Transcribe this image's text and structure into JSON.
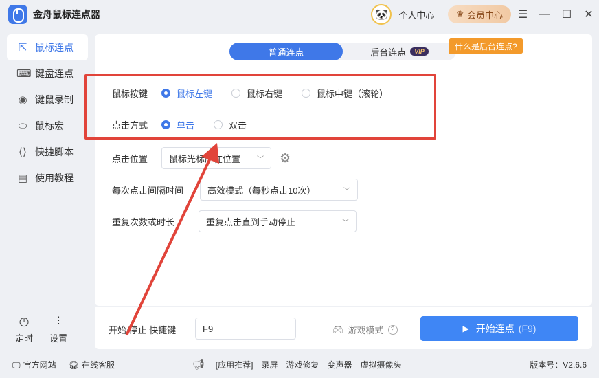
{
  "app": {
    "title": "金舟鼠标连点器"
  },
  "header": {
    "user_center": "个人中心",
    "vip_center": "会员中心"
  },
  "sidebar": {
    "items": [
      {
        "label": "鼠标连点",
        "icon": "mouse-click-icon"
      },
      {
        "label": "键盘连点",
        "icon": "keyboard-icon"
      },
      {
        "label": "键鼠录制",
        "icon": "record-icon"
      },
      {
        "label": "鼠标宏",
        "icon": "mouse-icon"
      },
      {
        "label": "快捷脚本",
        "icon": "script-icon"
      },
      {
        "label": "使用教程",
        "icon": "tutorial-icon"
      }
    ],
    "timer": "定时",
    "settings": "设置"
  },
  "tabs": {
    "normal": "普通连点",
    "background": "后台连点",
    "vip_tag": "VIP",
    "tip": "什么是后台连点?"
  },
  "form": {
    "mouse_button_label": "鼠标按键",
    "mouse_buttons": [
      "鼠标左键",
      "鼠标右键",
      "鼠标中键（滚轮）"
    ],
    "click_type_label": "点击方式",
    "click_types": [
      "单击",
      "双击"
    ],
    "position_label": "点击位置",
    "position_value": "鼠标光标所在位置",
    "interval_label": "每次点击间隔时间",
    "interval_value": "高效模式（每秒点击10次）",
    "repeat_label": "重复次数或时长",
    "repeat_value": "重复点击直到手动停止"
  },
  "hotkey": {
    "label": "开始/停止 快捷键",
    "value": "F9",
    "game_mode": "游戏模式",
    "start_label": "开始连点",
    "start_key": "(F9)"
  },
  "footer": {
    "website": "官方网站",
    "support": "在线客服",
    "recommend": "[应用推荐]",
    "links": [
      "录屏",
      "游戏修复",
      "变声器",
      "虚拟摄像头"
    ],
    "version": "版本号：V2.6.6"
  },
  "colors": {
    "accent": "#3f78e8",
    "highlight": "#e1443a",
    "tip": "#f39a2b"
  }
}
